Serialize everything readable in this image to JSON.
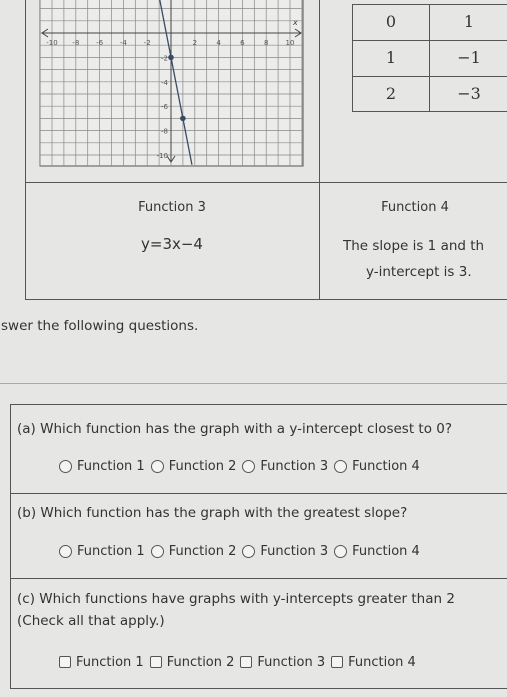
{
  "function1_graph": {
    "x_ticks": [
      "-10",
      "-8",
      "-6",
      "-4",
      "-2",
      "2",
      "4",
      "6",
      "8",
      "10"
    ],
    "y_ticks": [
      "-2",
      "-4",
      "-6",
      "-8",
      "-10"
    ],
    "x_axis_label": "x",
    "points": [
      [
        0,
        -2
      ],
      [
        1,
        -7
      ]
    ],
    "line_color": "#3a4a66"
  },
  "function2_table": {
    "rows": [
      [
        "0",
        "1"
      ],
      [
        "1",
        "−1"
      ],
      [
        "2",
        "−3"
      ]
    ]
  },
  "function3": {
    "title": "Function 3",
    "equation": "y=3x−4"
  },
  "function4": {
    "title": "Function 4",
    "line1": "The slope is 1 and th",
    "line2": "y-intercept is 3."
  },
  "instruction": "swer the following questions.",
  "questions": [
    {
      "text": "(a) Which function has the graph with a y-intercept closest to 0?",
      "type": "radio",
      "options": [
        "Function 1",
        "Function 2",
        "Function 3",
        "Function 4"
      ]
    },
    {
      "text": "(b) Which function has the graph with the greatest slope?",
      "type": "radio",
      "options": [
        "Function 1",
        "Function 2",
        "Function 3",
        "Function 4"
      ]
    },
    {
      "text": "(c) Which functions have graphs with y-intercepts greater than 2",
      "subtext": "(Check all that apply.)",
      "type": "checkbox",
      "options": [
        "Function 1",
        "Function 2",
        "Function 3",
        "Function 4"
      ]
    }
  ]
}
